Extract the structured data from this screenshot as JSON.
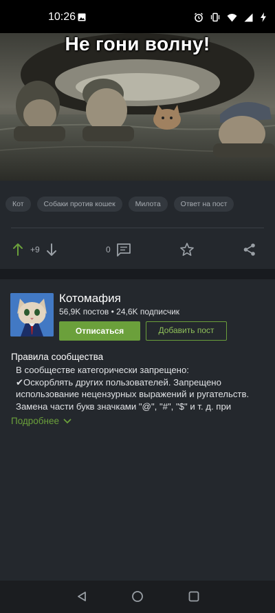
{
  "status_bar": {
    "time": "10:26"
  },
  "meme": {
    "caption": "Не гони волну!"
  },
  "post": {
    "tags": [
      "Кот",
      "Собаки против кошек",
      "Милота",
      "Ответ на пост"
    ],
    "rating": "+9",
    "comments_count": "0"
  },
  "community": {
    "name": "Котомафия",
    "stats": "56,9K постов • 24,6K подписчик",
    "unsubscribe_label": "Отписаться",
    "add_post_label": "Добавить пост",
    "rules_title": "Правила сообщества",
    "rules_text": [
      "В сообществе категорически запрещено:",
      "✔Оскорблять других пользователей. Запрещено",
      "использование нецензурных выражений и ругательств.",
      "Замена части букв значками \"@\", \"#\", \"$\" и т. д. при"
    ],
    "more_label": "Подробнее"
  },
  "colors": {
    "accent": "#6ba03b",
    "card": "#24282d",
    "background": "#181b1f"
  }
}
